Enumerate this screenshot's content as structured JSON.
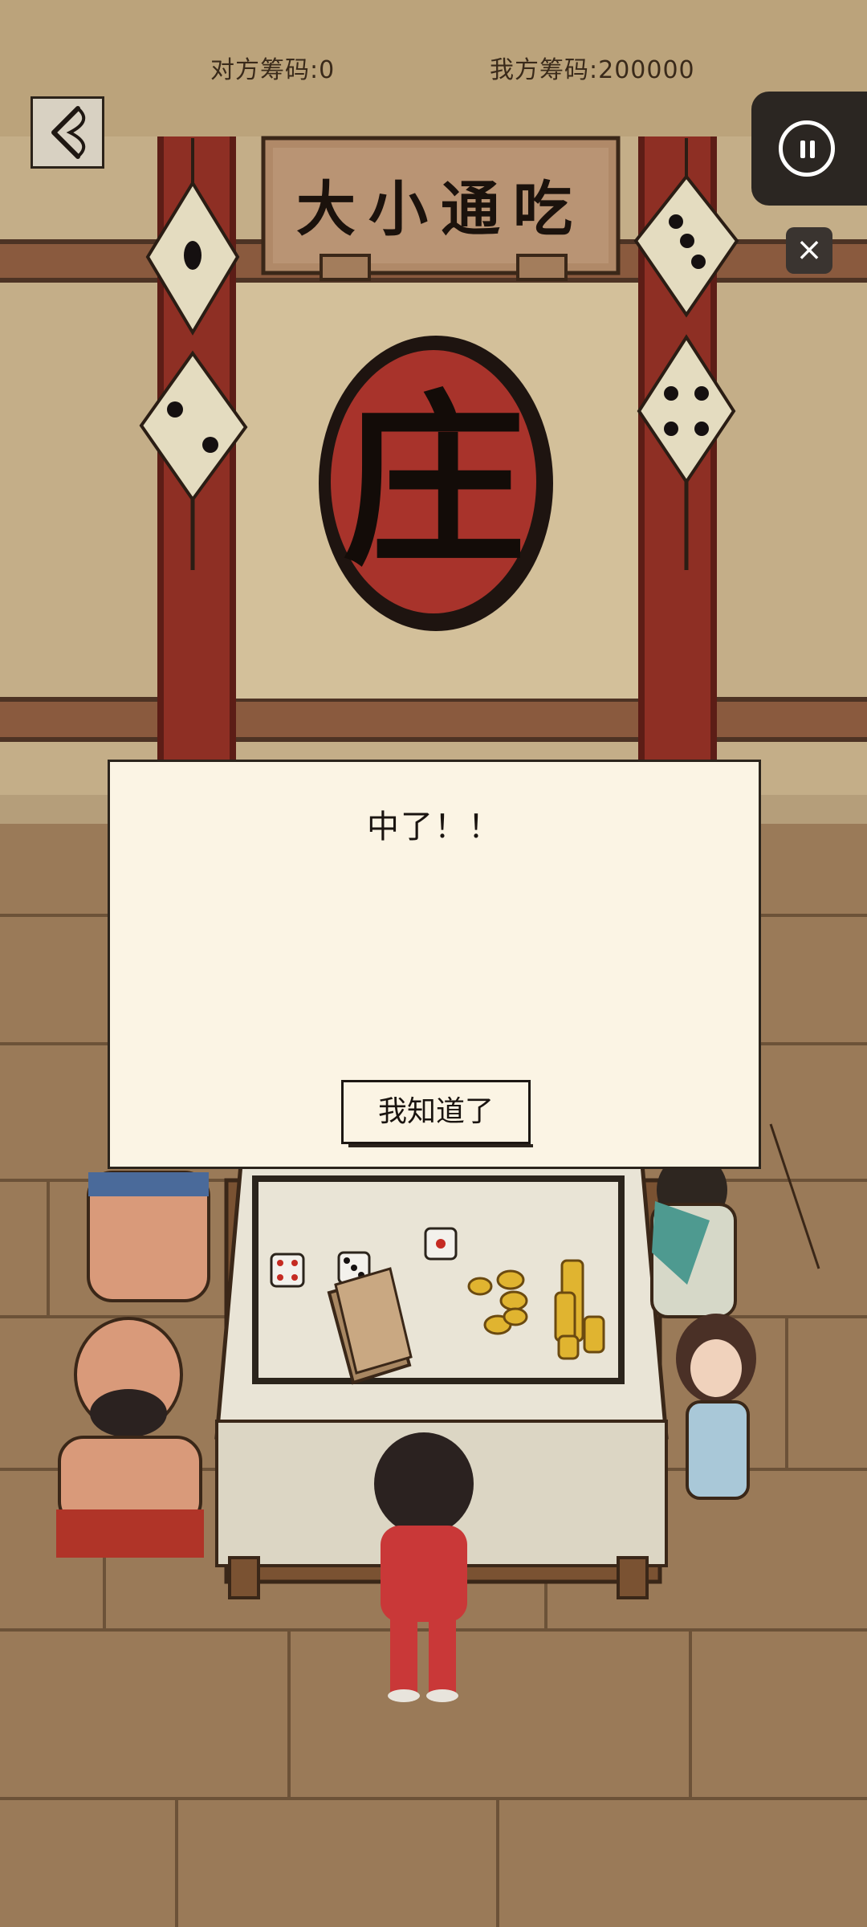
{
  "hud": {
    "opponent_chips": "对方筹码:0",
    "my_chips": "我方筹码:200000"
  },
  "scene": {
    "sign_text": "大小通吃",
    "banker_char": "庄"
  },
  "dialog": {
    "message": "中了！！",
    "confirm_label": "我知道了"
  },
  "icons": {
    "back": "back-arrow-icon",
    "pause": "pause-icon",
    "close": "close-icon"
  },
  "colors": {
    "wall": "#c9b58e",
    "pillar": "#8e2f24",
    "floor": "#9a7a58",
    "dialog_bg": "#fbf4e4",
    "seal_red": "#a8332b"
  }
}
